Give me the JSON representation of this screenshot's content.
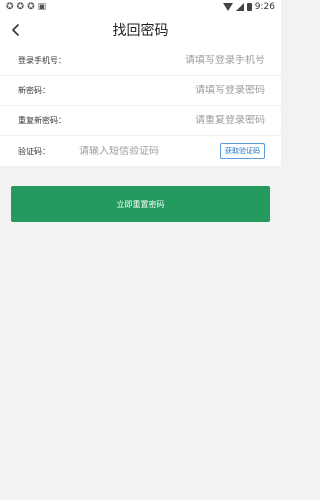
{
  "status_bar": {
    "time": "9:26",
    "left_icons": [
      "sync-icon",
      "sync-icon",
      "sync-icon",
      "notification-icon"
    ]
  },
  "header": {
    "title": "找回密码",
    "back_icon": "chevron-left-icon"
  },
  "form": {
    "phone": {
      "label": "登录手机号：",
      "placeholder": "请填写登录手机号"
    },
    "new_password": {
      "label": "新密码：",
      "placeholder": "请填写登录密码"
    },
    "repeat_password": {
      "label": "重复新密码：",
      "placeholder": "请重复登录密码"
    },
    "verify_code": {
      "label": "验证码：",
      "placeholder": "请输入短信验证码",
      "button_label": "获取验证码"
    }
  },
  "submit": {
    "label": "立即重置密码"
  },
  "colors": {
    "accent": "#259a5e",
    "link": "#1f74c7",
    "background": "#f2f2f2"
  }
}
